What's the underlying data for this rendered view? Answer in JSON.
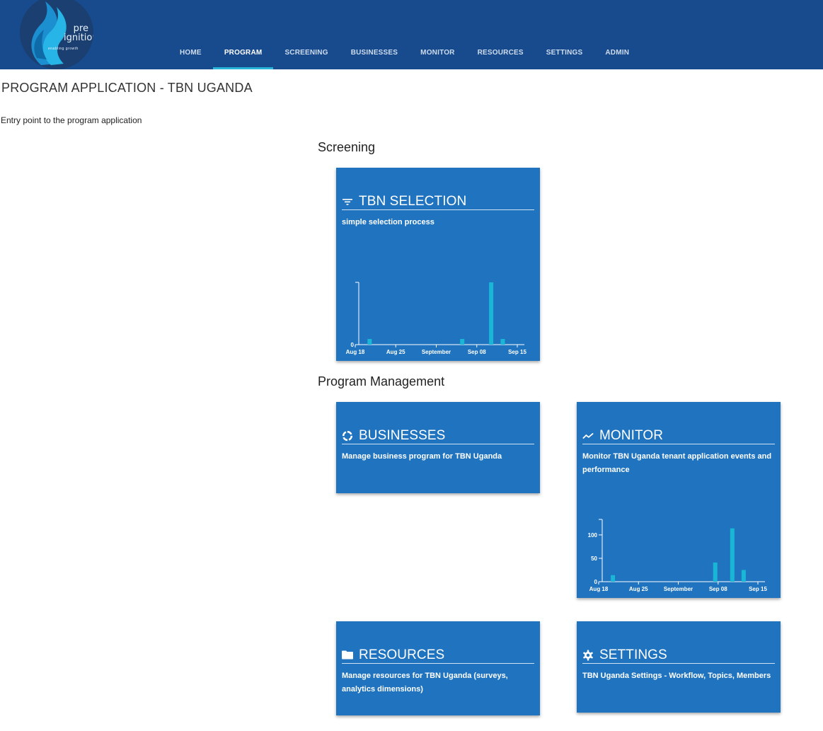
{
  "header": {
    "logo": {
      "main": "pre",
      "main2": "ignition",
      "sub": "enabling    growth"
    },
    "nav": [
      {
        "label": "HOME",
        "active": false
      },
      {
        "label": "PROGRAM",
        "active": true
      },
      {
        "label": "SCREENING",
        "active": false
      },
      {
        "label": "BUSINESSES",
        "active": false
      },
      {
        "label": "MONITOR",
        "active": false
      },
      {
        "label": "RESOURCES",
        "active": false
      },
      {
        "label": "SETTINGS",
        "active": false
      },
      {
        "label": "ADMIN",
        "active": false
      }
    ]
  },
  "page": {
    "title": "PROGRAM APPLICATION - TBN UGANDA",
    "description": "Entry point to the program application"
  },
  "sections": {
    "screening": "Screening",
    "management": "Program Management"
  },
  "cards": {
    "selection": {
      "title": "TBN SELECTION",
      "icon": "filter-icon",
      "desc": "simple selection process"
    },
    "businesses": {
      "title": "BUSINESSES",
      "icon": "donut-icon",
      "desc": "Manage business program for TBN Uganda"
    },
    "monitor": {
      "title": "MONITOR",
      "icon": "trending-icon",
      "desc": "Monitor TBN Uganda tenant application events and performance"
    },
    "resources": {
      "title": "RESOURCES",
      "icon": "folder-icon",
      "desc": "Manage resources for TBN Uganda (surveys, analytics dimensions)"
    },
    "settings": {
      "title": "SETTINGS",
      "icon": "gear-icon",
      "desc": "TBN Uganda Settings - Workflow, Topics, Members"
    }
  },
  "colors": {
    "header": "#174b8d",
    "card": "#1f73bf",
    "bar": "#1ab6d6",
    "accent": "#28b4d8"
  },
  "chart_data": [
    {
      "type": "bar",
      "x_ticks": [
        "Aug 18",
        "Aug 25",
        "September",
        "Sep 08",
        "Sep 15"
      ],
      "y_ticks": [
        "0"
      ],
      "ylim": [
        0,
        11
      ],
      "x": [
        "2024-08-20",
        "2024-09-05",
        "2024-09-10",
        "2024-09-12"
      ],
      "values": [
        1,
        1,
        11,
        1
      ]
    },
    {
      "type": "bar",
      "x_ticks": [
        "Aug 18",
        "Aug 25",
        "September",
        "Sep 08",
        "Sep 15"
      ],
      "y_ticks": [
        "0",
        "50",
        "100"
      ],
      "ylim": [
        0,
        115
      ],
      "x": [
        "2024-08-20",
        "2024-09-07",
        "2024-09-10",
        "2024-09-12"
      ],
      "values": [
        14,
        41,
        114,
        25
      ]
    }
  ]
}
